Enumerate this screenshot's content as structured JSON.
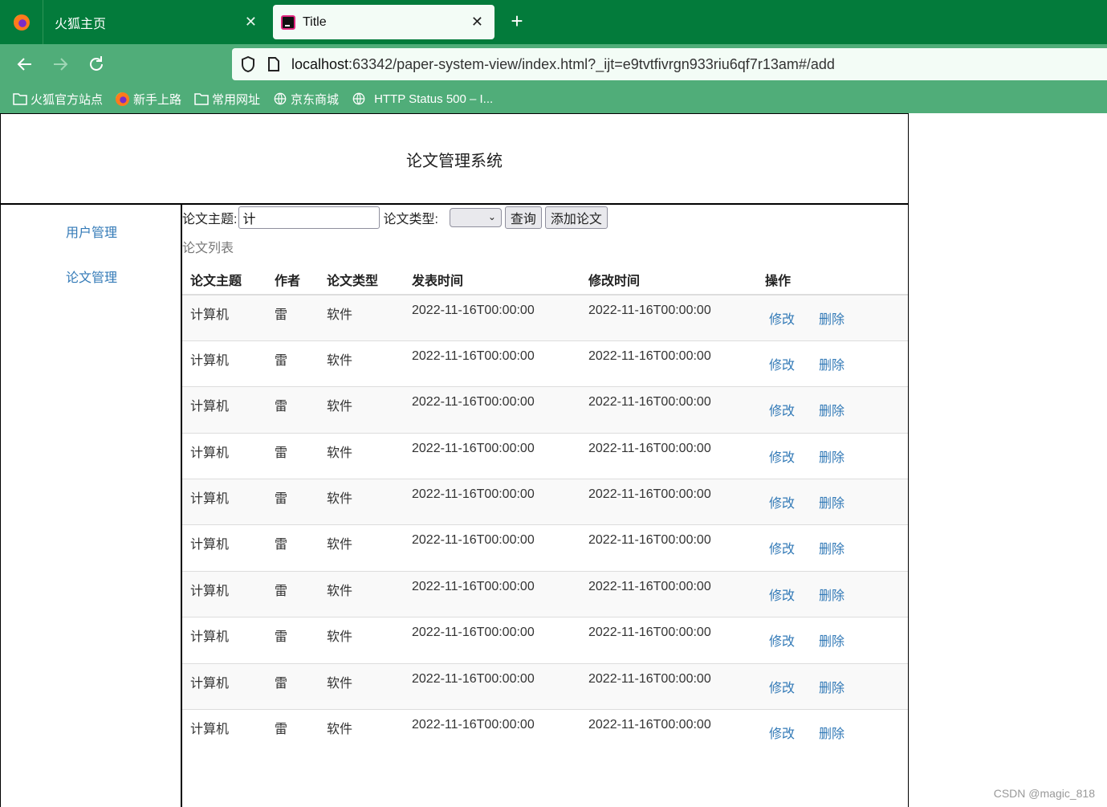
{
  "browser": {
    "tabs": [
      {
        "label": "火狐主页",
        "active": false
      },
      {
        "label": "Title",
        "active": true
      }
    ],
    "url": {
      "host": "localhost",
      "rest": ":63342/paper-system-view/index.html?_ijt=e9tvtfivrgn933riu6qf7r13am#/add"
    },
    "bookmarks": [
      {
        "label": "火狐官方站点",
        "icon": "folder-icon"
      },
      {
        "label": "新手上路",
        "icon": "firefox-icon"
      },
      {
        "label": "常用网址",
        "icon": "folder-icon"
      },
      {
        "label": "京东商城",
        "icon": "globe-icon"
      },
      {
        "label": "HTTP Status 500 – I...",
        "icon": "globe-icon"
      }
    ]
  },
  "page": {
    "title": "论文管理系统",
    "sidebar": [
      {
        "label": "用户管理"
      },
      {
        "label": "论文管理"
      }
    ],
    "search": {
      "topic_label": "论文主题:",
      "topic_value": "计",
      "type_label": "论文类型:",
      "type_value": "",
      "query_button": "查询",
      "add_button": "添加论文"
    },
    "list_title": "论文列表",
    "table": {
      "columns": [
        "论文主题",
        "作者",
        "论文类型",
        "发表时间",
        "修改时间",
        "操作"
      ],
      "edit_label": "修改",
      "delete_label": "删除",
      "rows": [
        {
          "topic": "计算机",
          "author": "雷",
          "type": "软件",
          "published": "2022-11-16T00:00:00",
          "modified": "2022-11-16T00:00:00"
        },
        {
          "topic": "计算机",
          "author": "雷",
          "type": "软件",
          "published": "2022-11-16T00:00:00",
          "modified": "2022-11-16T00:00:00"
        },
        {
          "topic": "计算机",
          "author": "雷",
          "type": "软件",
          "published": "2022-11-16T00:00:00",
          "modified": "2022-11-16T00:00:00"
        },
        {
          "topic": "计算机",
          "author": "雷",
          "type": "软件",
          "published": "2022-11-16T00:00:00",
          "modified": "2022-11-16T00:00:00"
        },
        {
          "topic": "计算机",
          "author": "雷",
          "type": "软件",
          "published": "2022-11-16T00:00:00",
          "modified": "2022-11-16T00:00:00"
        },
        {
          "topic": "计算机",
          "author": "雷",
          "type": "软件",
          "published": "2022-11-16T00:00:00",
          "modified": "2022-11-16T00:00:00"
        },
        {
          "topic": "计算机",
          "author": "雷",
          "type": "软件",
          "published": "2022-11-16T00:00:00",
          "modified": "2022-11-16T00:00:00"
        },
        {
          "topic": "计算机",
          "author": "雷",
          "type": "软件",
          "published": "2022-11-16T00:00:00",
          "modified": "2022-11-16T00:00:00"
        },
        {
          "topic": "计算机",
          "author": "雷",
          "type": "软件",
          "published": "2022-11-16T00:00:00",
          "modified": "2022-11-16T00:00:00"
        },
        {
          "topic": "计算机",
          "author": "雷",
          "type": "软件",
          "published": "2022-11-16T00:00:00",
          "modified": "2022-11-16T00:00:00"
        }
      ]
    }
  },
  "watermark": "CSDN @magic_818",
  "colors": {
    "tabbar": "#037b3b",
    "toolbar": "#50ad79",
    "link": "#337ab7",
    "stripe": "#f9f9f9"
  }
}
